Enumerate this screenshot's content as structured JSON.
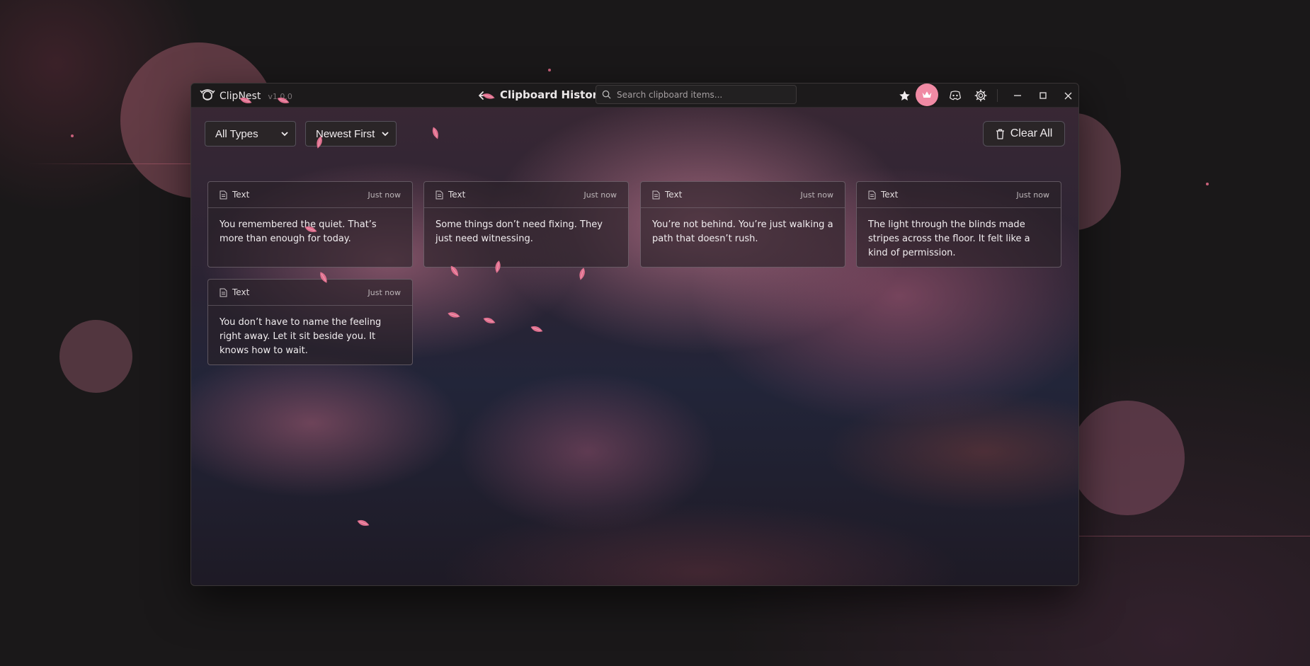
{
  "app": {
    "name": "ClipNest",
    "version": "v1.0.0",
    "page_title": "Clipboard History",
    "accent_color": "#f08aa4"
  },
  "search": {
    "placeholder": "Search clipboard items..."
  },
  "toolbar": {
    "icons": [
      "star-icon",
      "crown-icon",
      "discord-icon",
      "gear-icon",
      "minimize-icon",
      "maximize-icon",
      "close-icon"
    ]
  },
  "filters": {
    "type_selected": "All Types",
    "sort_selected": "Newest First"
  },
  "actions": {
    "clear_all_label": "Clear All"
  },
  "clips": [
    {
      "type": "Text",
      "time": "Just now",
      "content": "You remembered the quiet. That’s more than enough for today."
    },
    {
      "type": "Text",
      "time": "Just now",
      "content": "Some things don’t need fixing. They just need witnessing."
    },
    {
      "type": "Text",
      "time": "Just now",
      "content": "You’re not behind. You’re just walking a path that doesn’t rush."
    },
    {
      "type": "Text",
      "time": "Just now",
      "content": "The light through the blinds made stripes across the floor. It felt like a kind of permission."
    },
    {
      "type": "Text",
      "time": "Just now",
      "content": "You don’t have to name the feeling right away. Let it sit beside you. It knows how to wait."
    }
  ]
}
